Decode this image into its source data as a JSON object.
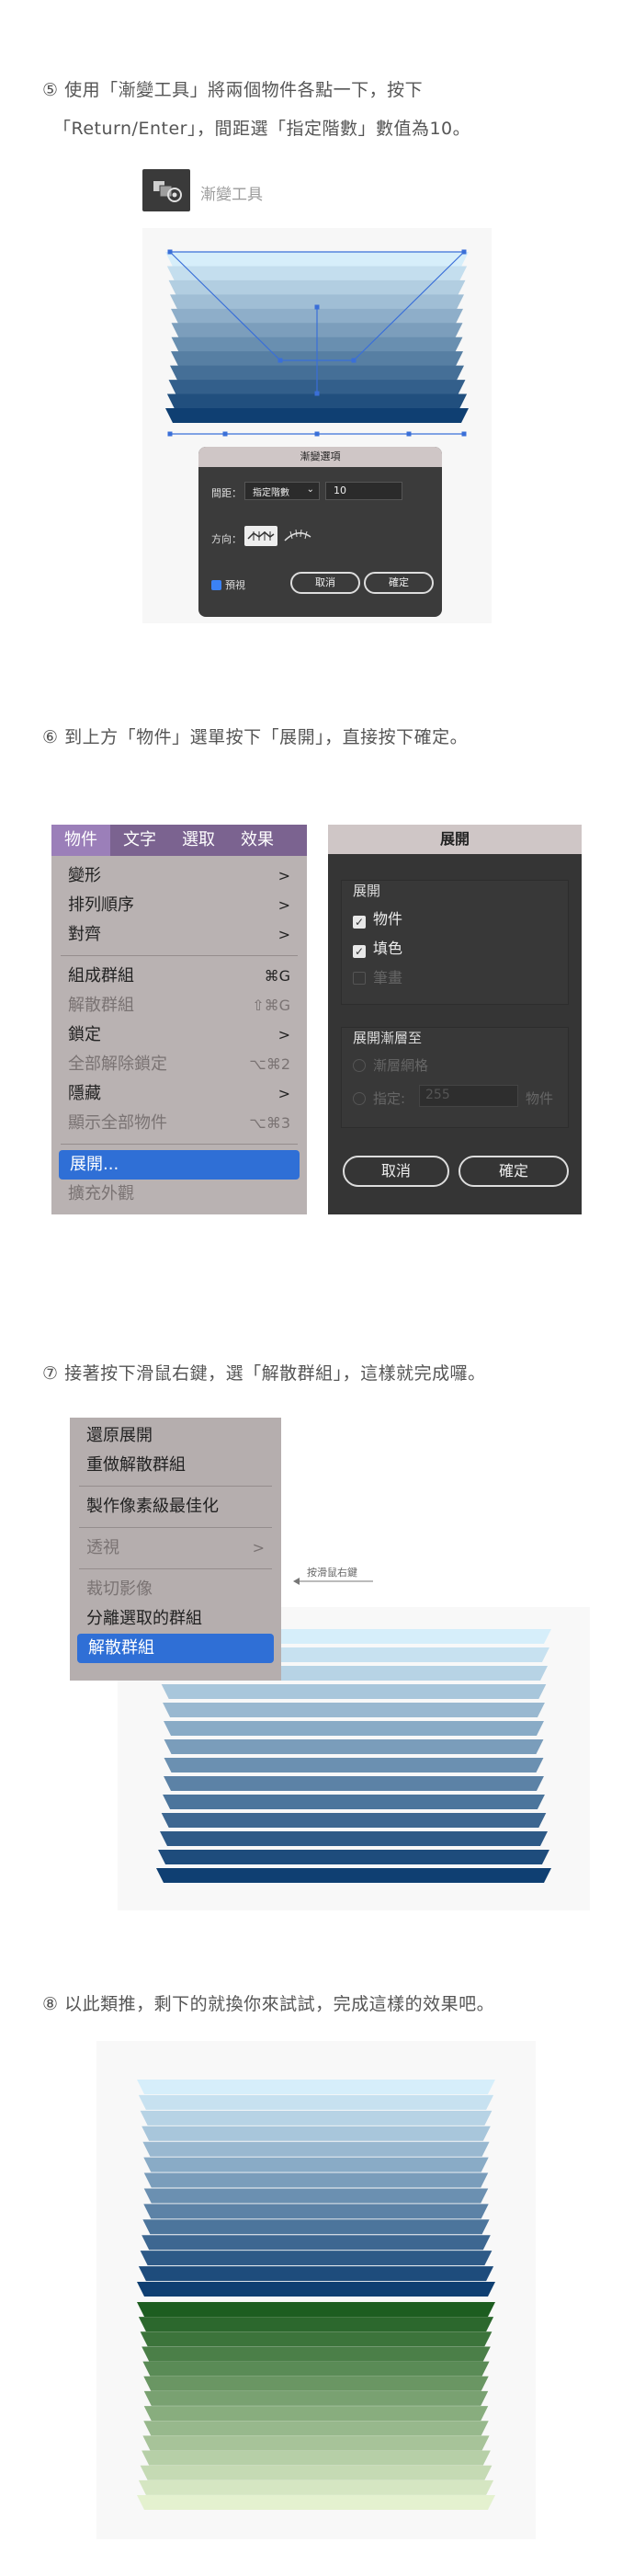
{
  "step5": {
    "line1": "⑤ 使用「漸變工具」將兩個物件各點一下，按下",
    "line2": "「Return/Enter」，間距選「指定階數」數值為10。",
    "tool_label": "漸變工具",
    "dialog": {
      "title": "漸變選項",
      "spacing_label": "間距：",
      "spacing_value": "指定階數",
      "steps_value": "10",
      "orientation_label": "方向：",
      "preview_label": "預視",
      "cancel": "取消",
      "ok": "確定"
    }
  },
  "step6": {
    "text": "⑥ 到上方「物件」選單按下「展開」，直接按下確定。",
    "menubar": [
      "物件",
      "文字",
      "選取",
      "效果"
    ],
    "menu": [
      {
        "label": "變形",
        "shortcut": ">",
        "disabled": false
      },
      {
        "label": "排列順序",
        "shortcut": ">",
        "disabled": false
      },
      {
        "label": "對齊",
        "shortcut": ">",
        "disabled": false
      },
      {
        "sep": true
      },
      {
        "label": "組成群組",
        "shortcut": "⌘G",
        "disabled": false
      },
      {
        "label": "解散群組",
        "shortcut": "⇧⌘G",
        "disabled": true
      },
      {
        "label": "鎖定",
        "shortcut": ">",
        "disabled": false
      },
      {
        "label": "全部解除鎖定",
        "shortcut": "⌥⌘2",
        "disabled": true
      },
      {
        "label": "隱藏",
        "shortcut": ">",
        "disabled": false
      },
      {
        "label": "顯示全部物件",
        "shortcut": "⌥⌘3",
        "disabled": true
      },
      {
        "sep": true
      },
      {
        "label": "展開...",
        "shortcut": "",
        "selected": true
      },
      {
        "label": "擴充外觀",
        "shortcut": "",
        "disabled": true
      }
    ],
    "expand_dialog": {
      "title": "展開",
      "section1": "展開",
      "object": "物件",
      "fill": "填色",
      "stroke": "筆畫",
      "section2": "展開漸層至",
      "gradient_mesh": "漸層網格",
      "specify": "指定:",
      "specify_value": "255",
      "objects_suffix": "物件",
      "cancel": "取消",
      "ok": "確定"
    }
  },
  "step7": {
    "text": "⑦ 接著按下滑鼠右鍵，選「解散群組」，這樣就完成囉。",
    "annotation": "按滑鼠右鍵",
    "menu": [
      {
        "label": "還原展開",
        "disabled": false
      },
      {
        "label": "重做解散群組",
        "disabled": false
      },
      {
        "sep": true
      },
      {
        "label": "製作像素級最佳化",
        "disabled": false
      },
      {
        "sep": true
      },
      {
        "label": "透視",
        "disabled": true,
        "shortcut": ">"
      },
      {
        "sep": true
      },
      {
        "label": "裁切影像",
        "disabled": true
      },
      {
        "label": "分離選取的群組",
        "disabled": false
      },
      {
        "label": "解散群組",
        "selected": true
      }
    ]
  },
  "step8": {
    "text": "⑧ 以此類推，剩下的就換你來試試，完成這樣的效果吧。"
  },
  "colors": {
    "blue_light": "#d6eefa",
    "blue_dark": "#0f3f72",
    "green_light": "#e4f1cf",
    "green_dark": "#1d5d20",
    "accent": "#2f6fd6"
  }
}
